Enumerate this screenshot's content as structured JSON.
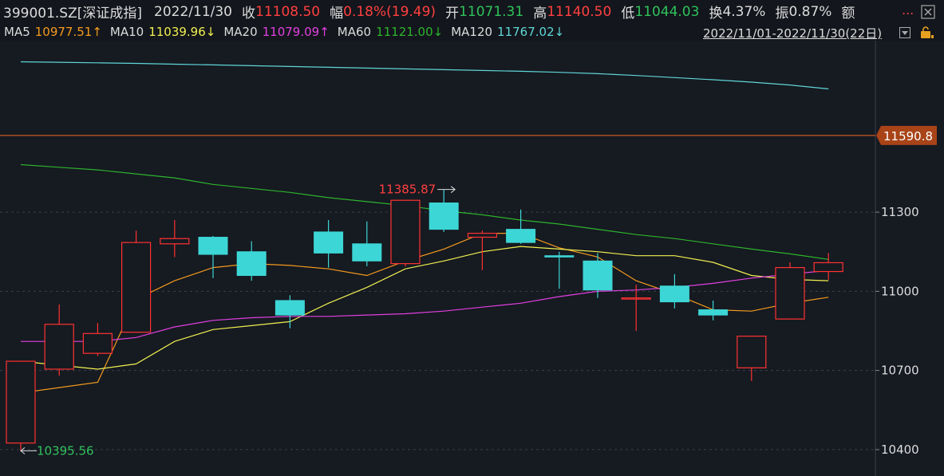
{
  "header": {
    "code": "399001.SZ[深证成指]",
    "date": "2022/11/30",
    "close_label": "收",
    "close_value": "11108.50",
    "change_label": "幅",
    "change_value": "0.18%(19.49)",
    "open_label": "开",
    "open_value": "11071.31",
    "high_label": "高",
    "high_value": "11140.50",
    "low_label": "低",
    "low_value": "11044.03",
    "turnover_label": "换",
    "turnover_value": "4.37%",
    "amplitude_label": "振",
    "amplitude_value": "0.87%",
    "amount_label": "额",
    "more_label": "..."
  },
  "ma_bar": {
    "ma5_label": "MA5",
    "ma5_value": "10977.51↑",
    "ma10_label": "MA10",
    "ma10_value": "11039.96↓",
    "ma20_label": "MA20",
    "ma20_value": "11079.09↑",
    "ma60_label": "MA60",
    "ma60_value": "11121.00↓",
    "ma120_label": "MA120",
    "ma120_value": "11767.02↓",
    "range_label": "2022/11/01-2022/11/30(22日)"
  },
  "colors": {
    "up": "#ff3232",
    "down": "#3dd6d6",
    "ma5": "#f39a1e",
    "ma10": "#f0f050",
    "ma20": "#e040e0",
    "ma60": "#2db32d",
    "ma120": "#5fd6d6",
    "price_line": "#c85a1e",
    "grid": "#3a3f4a",
    "background": "#161a21"
  },
  "icons": {
    "close": "window-close-icon",
    "dropdown": "dropdown-arrow-icon",
    "lock": "lock-icon"
  },
  "chart_data": {
    "type": "candlestick",
    "ylim": [
      10300,
      11950
    ],
    "y_ticks": [
      10400,
      10700,
      11000,
      11300
    ],
    "current_price_line": 11590.8,
    "current_price_label": "11590.8",
    "max_label": "11385.87",
    "min_label": "10395.56",
    "candles": [
      {
        "open": 10425,
        "high": 10735,
        "low": 10395.56,
        "close": 10735
      },
      {
        "open": 10705,
        "high": 10950,
        "low": 10680,
        "close": 10875
      },
      {
        "open": 10765,
        "high": 10880,
        "low": 10755,
        "close": 10840
      },
      {
        "open": 10845,
        "high": 11230,
        "low": 10845,
        "close": 11185
      },
      {
        "open": 11180,
        "high": 11270,
        "low": 11130,
        "close": 11200
      },
      {
        "open": 11205,
        "high": 11210,
        "low": 11050,
        "close": 11140
      },
      {
        "open": 11150,
        "high": 11190,
        "low": 11040,
        "close": 11060
      },
      {
        "open": 10965,
        "high": 10985,
        "low": 10860,
        "close": 10910
      },
      {
        "open": 11225,
        "high": 11270,
        "low": 11090,
        "close": 11145
      },
      {
        "open": 11180,
        "high": 11265,
        "low": 11095,
        "close": 11115
      },
      {
        "open": 11105,
        "high": 11345,
        "low": 11095,
        "close": 11345
      },
      {
        "open": 11335,
        "high": 11385.87,
        "low": 11225,
        "close": 11235
      },
      {
        "open": 11205,
        "high": 11230,
        "low": 11080,
        "close": 11220
      },
      {
        "open": 11235,
        "high": 11310,
        "low": 11180,
        "close": 11185
      },
      {
        "open": 11135,
        "high": 11150,
        "low": 11010,
        "close": 11130
      },
      {
        "open": 11115,
        "high": 11145,
        "low": 10975,
        "close": 11005
      },
      {
        "open": 10975,
        "high": 11025,
        "low": 10850,
        "close": 10975
      },
      {
        "open": 11020,
        "high": 11065,
        "low": 10935,
        "close": 10960
      },
      {
        "open": 10930,
        "high": 10965,
        "low": 10890,
        "close": 10910
      },
      {
        "open": 10710,
        "high": 10830,
        "low": 10660,
        "close": 10830
      },
      {
        "open": 10895,
        "high": 11110,
        "low": 10895,
        "close": 11090
      },
      {
        "open": 11075,
        "high": 11145,
        "low": 11044,
        "close": 11108.5
      }
    ],
    "series": [
      {
        "name": "MA5",
        "values": [
          10615,
          10635,
          10655,
          10970,
          11040,
          11090,
          11105,
          11098,
          11085,
          11060,
          11115,
          11160,
          11220,
          11220,
          11165,
          11130,
          11040,
          10990,
          10930,
          10925,
          10955,
          10977.51
        ]
      },
      {
        "name": "MA10",
        "values": [
          10735,
          10720,
          10705,
          10725,
          10810,
          10855,
          10870,
          10885,
          10955,
          11015,
          11085,
          11115,
          11150,
          11170,
          11160,
          11150,
          11135,
          11135,
          11110,
          11060,
          11045,
          11039.96
        ]
      },
      {
        "name": "MA20",
        "values": [
          10810,
          10810,
          10810,
          10825,
          10865,
          10890,
          10900,
          10905,
          10905,
          10910,
          10915,
          10925,
          10940,
          10955,
          10980,
          11000,
          11005,
          11015,
          11030,
          11050,
          11065,
          11079.09
        ]
      },
      {
        "name": "MA60",
        "values": [
          11480,
          11470,
          11460,
          11445,
          11430,
          11405,
          11390,
          11375,
          11355,
          11340,
          11325,
          11305,
          11290,
          11270,
          11255,
          11235,
          11215,
          11200,
          11180,
          11160,
          11142,
          11121.0
        ]
      },
      {
        "name": "MA120",
        "values": [
          11870,
          11868,
          11866,
          11864,
          11861,
          11858,
          11855,
          11852,
          11849,
          11846,
          11843,
          11840,
          11837,
          11834,
          11830,
          11825,
          11818,
          11810,
          11802,
          11793,
          11782,
          11767.02
        ]
      }
    ]
  }
}
